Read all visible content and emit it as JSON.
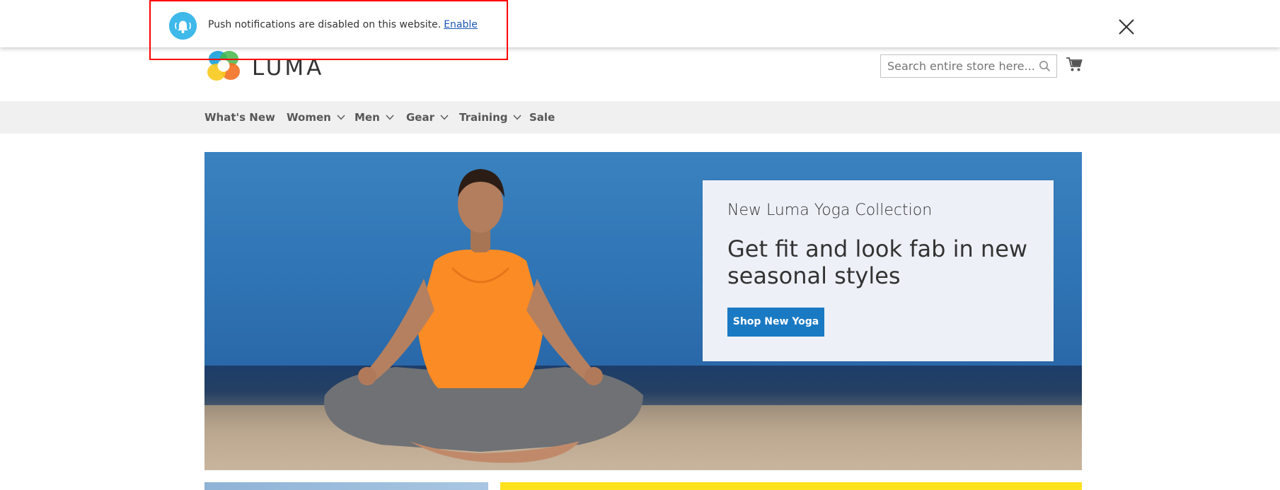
{
  "notification": {
    "message": "Push notifications are disabled on this website.",
    "link_label": "Enable",
    "icon": "bell-icon",
    "close_icon": "close-icon",
    "icon_color": "#3fb8ea",
    "highlight_color": "#ff0000"
  },
  "header": {
    "logo_text": "LUMA",
    "search_placeholder": "Search entire store here...",
    "search_icon": "search-icon",
    "cart_icon": "cart-icon"
  },
  "nav": {
    "items": [
      {
        "label": "What's New",
        "has_dropdown": false
      },
      {
        "label": "Women",
        "has_dropdown": true
      },
      {
        "label": "Men",
        "has_dropdown": true
      },
      {
        "label": "Gear",
        "has_dropdown": true
      },
      {
        "label": "Training",
        "has_dropdown": true
      },
      {
        "label": "Sale",
        "has_dropdown": false
      }
    ]
  },
  "hero": {
    "subtitle": "New Luma Yoga Collection",
    "title": "Get fit and look fab in new seasonal styles",
    "button_label": "Shop New Yoga",
    "button_color": "#1979c3"
  },
  "colors": {
    "nav_background": "#f0f0f0",
    "promo_accent": "#fde21d",
    "link": "#1a56b4"
  }
}
